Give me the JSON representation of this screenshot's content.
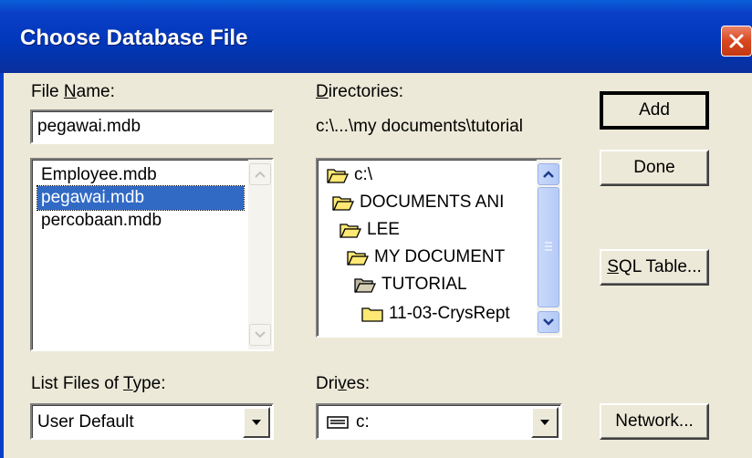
{
  "window": {
    "title": "Choose Database File",
    "close_glyph": "✕"
  },
  "file_name": {
    "label_pre": "File ",
    "label_ul": "N",
    "label_post": "ame:",
    "value": "pegawai.mdb"
  },
  "files": {
    "items": [
      {
        "label": "Employee.mdb",
        "selected": false
      },
      {
        "label": "pegawai.mdb",
        "selected": true
      },
      {
        "label": "percobaan.mdb",
        "selected": false
      }
    ]
  },
  "directories": {
    "label_ul": "D",
    "label_post": "irectories:",
    "current_path": "c:\\...\\my documents\\tutorial",
    "items": [
      {
        "label": "c:\\",
        "state": "open",
        "level": 0
      },
      {
        "label": "DOCUMENTS ANI",
        "state": "open",
        "level": 1
      },
      {
        "label": "LEE",
        "state": "open",
        "level": 2
      },
      {
        "label": "MY DOCUMENT",
        "state": "open",
        "level": 3
      },
      {
        "label": "TUTORIAL",
        "state": "open-selected",
        "level": 4
      },
      {
        "label": "11-03-CrysRept",
        "state": "closed",
        "level": 5
      }
    ]
  },
  "file_type": {
    "label_pre": "List Files of ",
    "label_ul": "T",
    "label_post": "ype:",
    "selected": "User Default"
  },
  "drives": {
    "label_pre": "Dri",
    "label_ul": "v",
    "label_post": "es:",
    "selected": "c:"
  },
  "buttons": {
    "add": "Add",
    "done": "Done",
    "sql_ul": "S",
    "sql_post": "QL Table...",
    "network": "Network..."
  },
  "colors": {
    "title_bar": "#0037b9",
    "selection": "#316ac5",
    "face": "#ece9d8",
    "folder": "#ffe873"
  },
  "icons": {
    "close": "close-icon",
    "scroll_up": "scroll-up-arrow-icon",
    "scroll_down": "scroll-down-arrow-icon",
    "open_folder": "open-folder-icon",
    "closed_folder": "closed-folder-icon",
    "drive": "hard-drive-icon",
    "dropdown": "dropdown-arrow-icon"
  }
}
